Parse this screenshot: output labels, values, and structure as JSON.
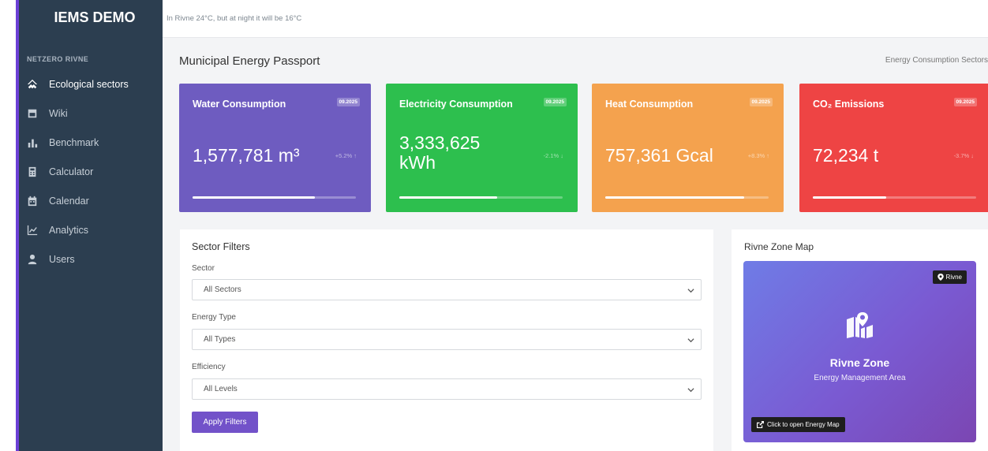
{
  "sidebar": {
    "brand": "IEMS DEMO",
    "section_label": "NETZERO RIVNE",
    "items": [
      {
        "label": "Ecological sectors",
        "icon": "ecological-sectors-icon"
      },
      {
        "label": "Wiki",
        "icon": "book-icon"
      },
      {
        "label": "Benchmark",
        "icon": "bar-chart-icon"
      },
      {
        "label": "Calculator",
        "icon": "calculator-icon"
      },
      {
        "label": "Calendar",
        "icon": "calendar-icon"
      },
      {
        "label": "Analytics",
        "icon": "line-chart-icon"
      },
      {
        "label": "Users",
        "icon": "user-icon"
      }
    ]
  },
  "header": {
    "weather": "In Rivne 24°C, but at night it will be 16°C"
  },
  "page": {
    "title": "Municipal Energy Passport",
    "right_label": "Energy Consumption Sectors"
  },
  "cards": [
    {
      "title": "Water Consumption",
      "date": "09.2025",
      "value": "1,577,781 m³",
      "trend": "+5.2% ↑",
      "progress": 0.75,
      "color": "#6e5cc0"
    },
    {
      "title": "Electricity Consumption",
      "date": "09.2025",
      "value": "3,333,625 kWh",
      "value_line1": "3,333,625",
      "value_line2": "kWh",
      "trend": "-2.1% ↓",
      "progress": 0.6,
      "color": "#2dbf4e"
    },
    {
      "title": "Heat Consumption",
      "date": "09.2025",
      "value": "757,361 Gcal",
      "trend": "+8.3% ↑",
      "progress": 0.85,
      "color": "#f4a24e"
    },
    {
      "title": "CO₂ Emissions",
      "date": "09.2025",
      "value": "72,234 t",
      "trend": "-3.7% ↓",
      "progress": 0.45,
      "color": "#ee4444"
    }
  ],
  "filters": {
    "title": "Sector Filters",
    "sector_label": "Sector",
    "sector_value": "All Sectors",
    "energy_label": "Energy Type",
    "energy_value": "All Types",
    "efficiency_label": "Efficiency",
    "efficiency_value": "All Levels",
    "apply_label": "Apply Filters"
  },
  "map": {
    "title": "Rivne Zone Map",
    "badge": "Rivne",
    "name": "Rivne Zone",
    "subtitle": "Energy Management Area",
    "open_label": "Click to open Energy Map"
  }
}
